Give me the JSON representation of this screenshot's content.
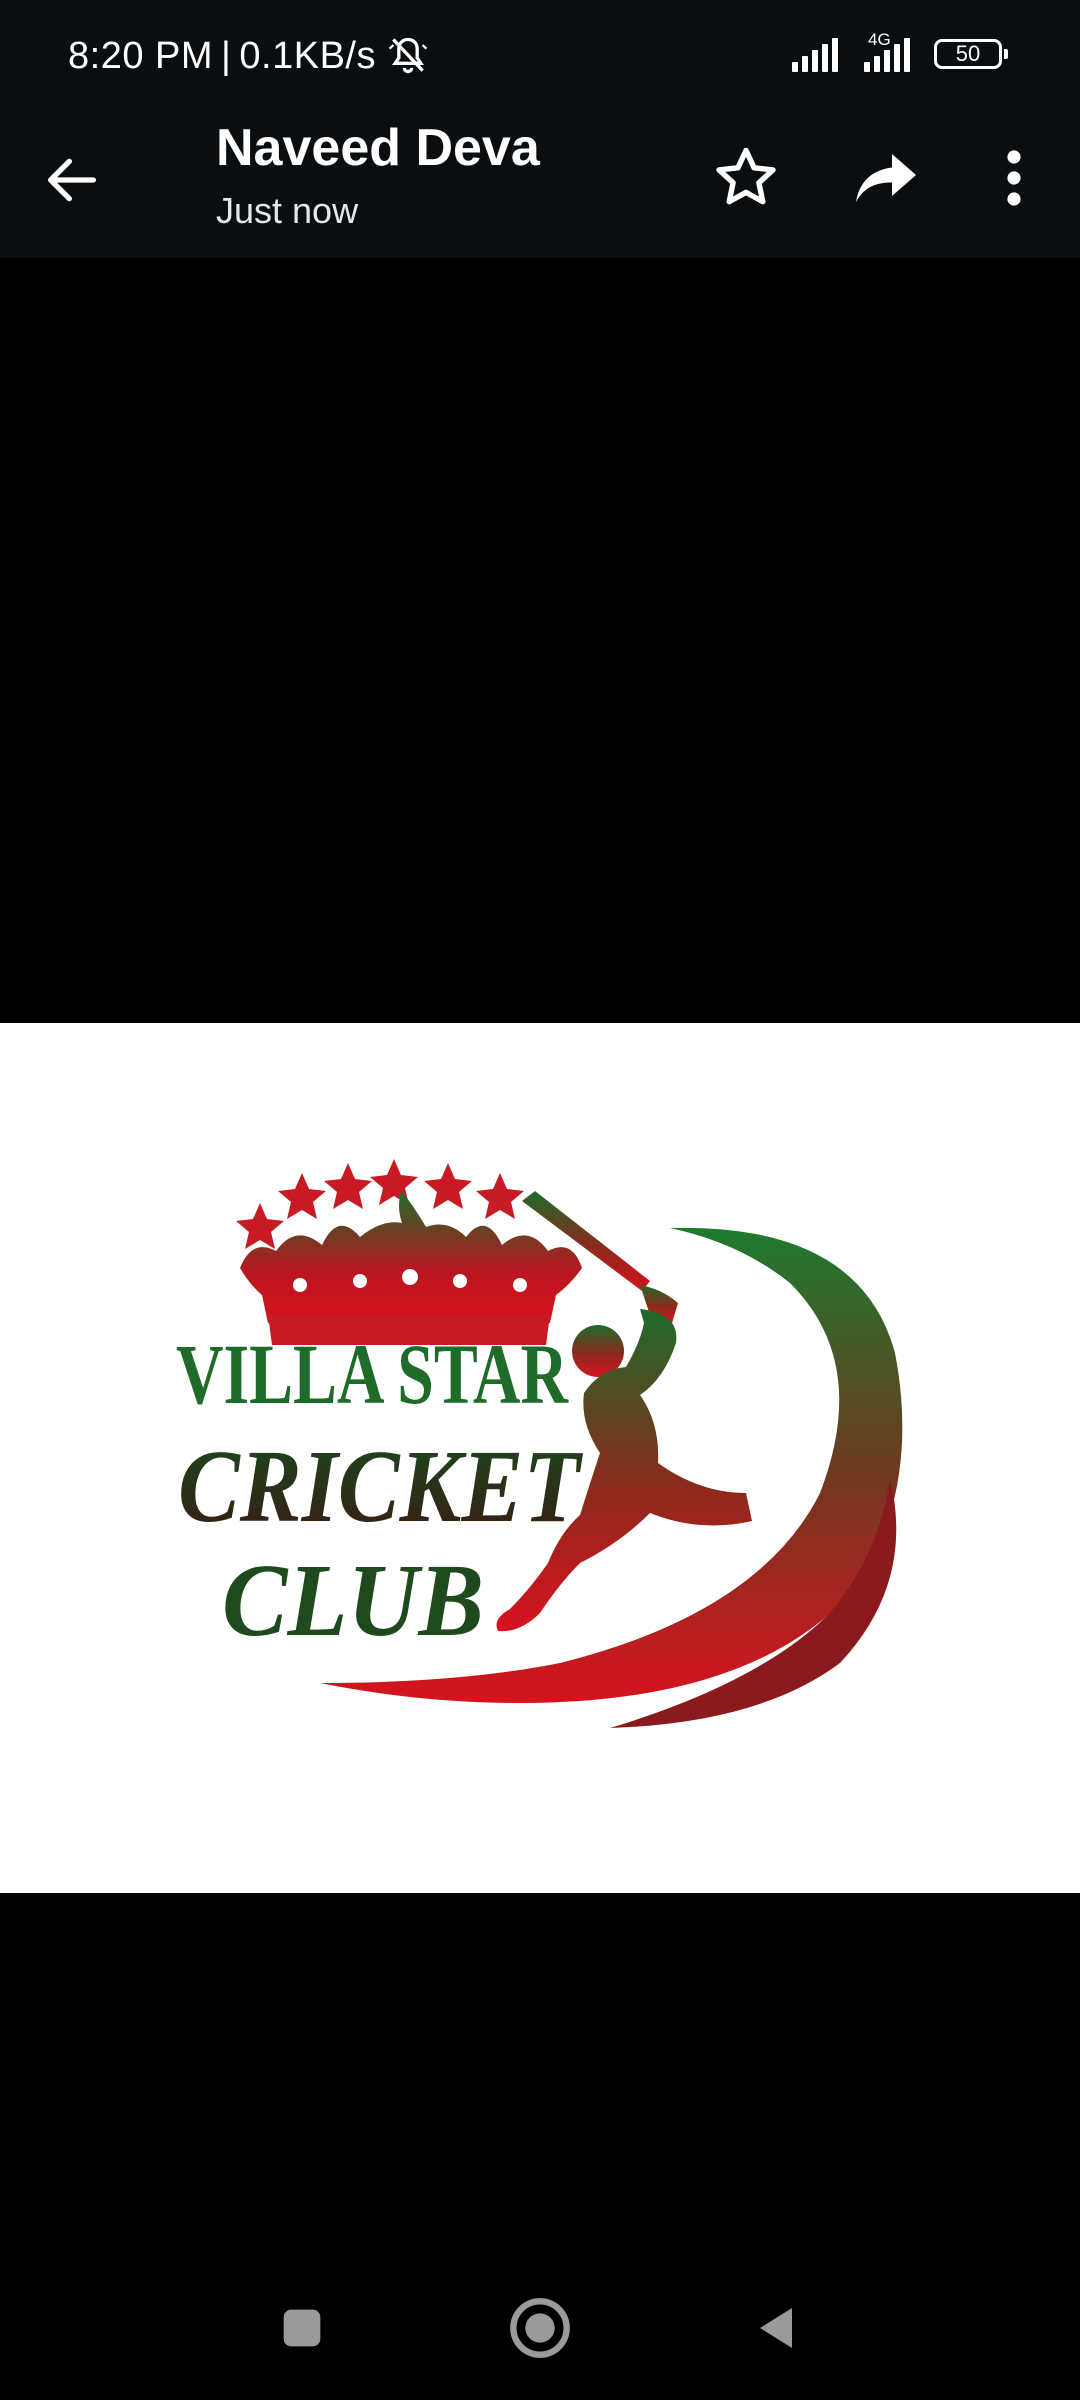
{
  "status_bar": {
    "time": "8:20 PM",
    "separator": "|",
    "net_speed": "0.1KB/s",
    "network_type": "4G",
    "battery": "50"
  },
  "app_bar": {
    "contact_name": "Naveed Deva",
    "timestamp": "Just now"
  },
  "image": {
    "logo_line1": "VILLA STAR",
    "logo_line2": "CRICKET",
    "logo_line3": "CLUB",
    "colors": {
      "green": "#1e6b2a",
      "red": "#c81a24",
      "dark": "#3a1a14"
    }
  },
  "icons": {
    "back": "arrow-left-icon",
    "star": "star-outline-icon",
    "forward": "forward-arrow-icon",
    "more": "more-vertical-icon",
    "mute": "notifications-off-icon",
    "recents": "square-icon",
    "home": "circle-icon",
    "nav_back": "triangle-back-icon"
  }
}
